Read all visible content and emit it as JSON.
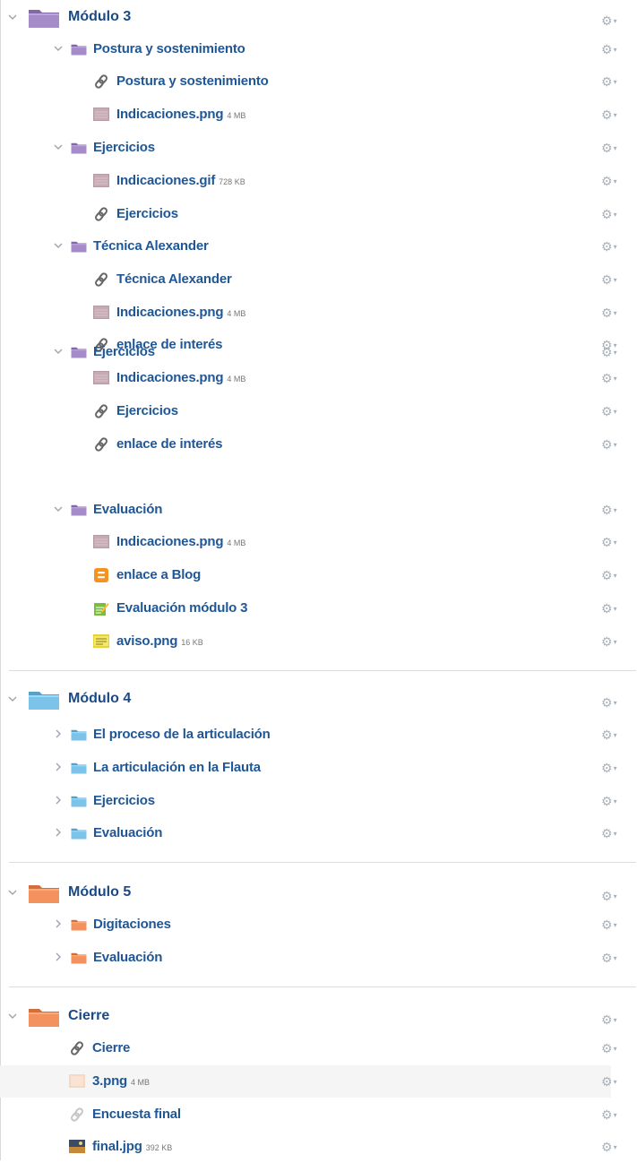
{
  "modules": [
    {
      "title": "Módulo 3",
      "color": "#a58cc9",
      "topics": [
        {
          "label": "Postura y sostenimiento",
          "items": [
            {
              "type": "link",
              "label": "Postura y sostenimiento"
            },
            {
              "type": "image",
              "label": "Indicaciones.png",
              "size": "4 MB"
            }
          ]
        },
        {
          "label": "Ejercicios",
          "items": [
            {
              "type": "image",
              "label": "Indicaciones.gif",
              "size": "728 KB"
            },
            {
              "type": "link",
              "label": "Ejercicios"
            }
          ]
        },
        {
          "label": "Técnica Alexander",
          "items": [
            {
              "type": "link",
              "label": "Técnica Alexander"
            },
            {
              "type": "image",
              "label": "Indicaciones.png",
              "size": "4 MB"
            },
            {
              "type": "link",
              "label": "enlace de interés"
            }
          ]
        },
        {
          "label": "Ejercicios",
          "items": [
            {
              "type": "image",
              "label": "Indicaciones.png",
              "size": "4 MB"
            },
            {
              "type": "link",
              "label": "Ejercicios"
            },
            {
              "type": "link",
              "label": "enlace de interés"
            }
          ]
        },
        {
          "label": "Evaluación",
          "items": [
            {
              "type": "image",
              "label": "Indicaciones.png",
              "size": "4 MB"
            },
            {
              "type": "blog",
              "label": "enlace a Blog"
            },
            {
              "type": "assign",
              "label": "Evaluación módulo 3"
            },
            {
              "type": "image-yellow",
              "label": "aviso.png",
              "size": "16 KB"
            }
          ]
        }
      ]
    },
    {
      "title": "Módulo 4",
      "color": "#7cc3ea",
      "topics": [
        {
          "label": "El proceso de la articulación"
        },
        {
          "label": "La articulación en la Flauta"
        },
        {
          "label": "Ejercicios"
        },
        {
          "label": "Evaluación"
        }
      ]
    },
    {
      "title": "Módulo 5",
      "color": "#f3915f",
      "topics": [
        {
          "label": "Digitaciones"
        },
        {
          "label": "Evaluación"
        }
      ]
    },
    {
      "title": "Cierre",
      "color": "#f3915f",
      "items": [
        {
          "type": "link",
          "label": "Cierre"
        },
        {
          "type": "image-peach",
          "label": "3.png",
          "size": "4 MB"
        },
        {
          "type": "link-faded",
          "label": "Encuesta final"
        },
        {
          "type": "image-photo",
          "label": "final.jpg",
          "size": "392 KB"
        }
      ]
    }
  ],
  "icons": {
    "link": "link-icon",
    "image": "image-file-icon",
    "blog": "blog-icon",
    "assign": "assignment-icon",
    "folder": "folder-icon",
    "gear": "gear-icon",
    "chevron_open": "chevron-down-icon",
    "chevron_closed": "chevron-right-icon"
  }
}
